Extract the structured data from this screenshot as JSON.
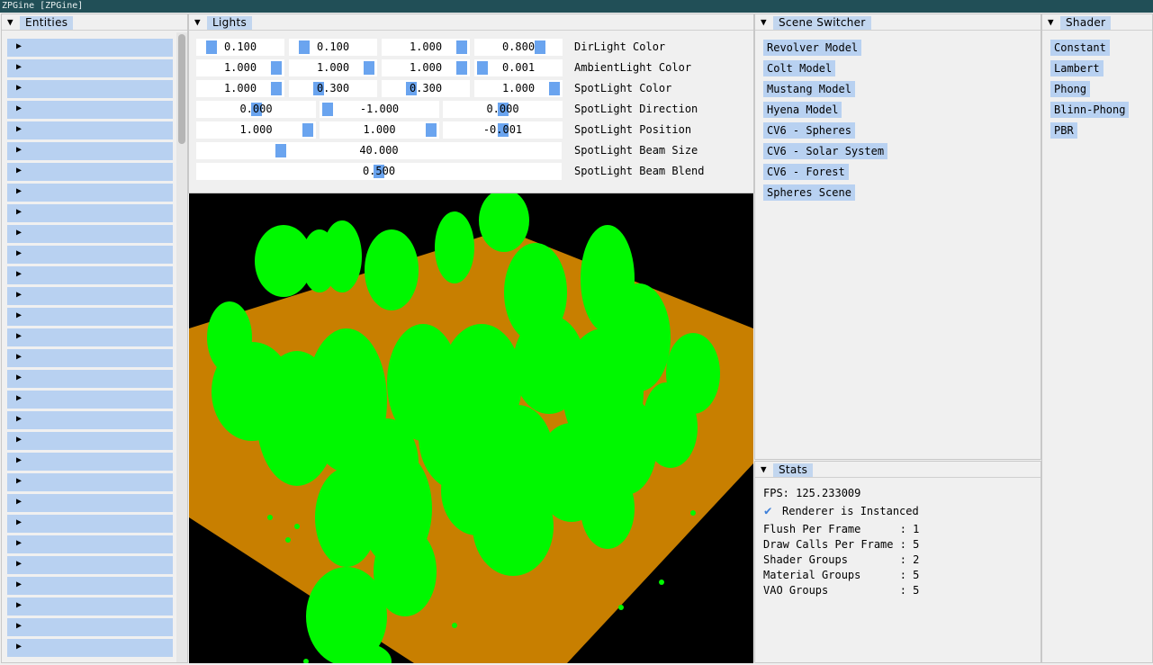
{
  "window": {
    "title": "ZPGine [ZPGine]"
  },
  "entities": {
    "title": "Entities",
    "row_count": 30
  },
  "lights": {
    "title": "Lights",
    "rows": [
      {
        "label": "DirLight Color",
        "values": [
          "0.100",
          "0.100",
          "1.000",
          "0.800"
        ],
        "fractions": [
          0.1,
          0.1,
          1.0,
          0.8
        ]
      },
      {
        "label": "AmbientLight Color",
        "values": [
          "1.000",
          "1.000",
          "1.000",
          "0.001"
        ],
        "fractions": [
          1.0,
          1.0,
          1.0,
          0.001
        ]
      },
      {
        "label": "SpotLight Color",
        "values": [
          "1.000",
          "0.300",
          "0.300",
          "1.000"
        ],
        "fractions": [
          1.0,
          0.3,
          0.3,
          1.0
        ]
      },
      {
        "label": "SpotLight Direction",
        "values": [
          "0.000",
          "-1.000",
          "0.000"
        ],
        "fractions": [
          0.5,
          0.0,
          0.5
        ]
      },
      {
        "label": "SpotLight Position",
        "values": [
          "1.000",
          "1.000",
          "-0.001"
        ],
        "fractions": [
          1.0,
          1.0,
          0.5
        ]
      },
      {
        "label": "SpotLight Beam Size",
        "values": [
          "40.000"
        ],
        "fractions": [
          0.22
        ]
      },
      {
        "label": "SpotLight Beam Blend",
        "values": [
          "0.500"
        ],
        "fractions": [
          0.5
        ]
      }
    ]
  },
  "viewport": {
    "colors": {
      "background": "#000000",
      "ground": "#c87f00",
      "trees": "#00f800"
    }
  },
  "scene_switcher": {
    "title": "Scene Switcher",
    "items": [
      "Revolver Model",
      "Colt Model",
      "Mustang Model",
      "Hyena Model",
      "CV6 - Spheres",
      "CV6 - Solar System",
      "CV6 - Forest",
      "Spheres Scene"
    ]
  },
  "stats": {
    "title": "Stats",
    "fps": "FPS: 125.233009",
    "instanced_label": "Renderer is Instanced",
    "instanced_checked": true,
    "lines": [
      "Flush Per Frame      : 1",
      "Draw Calls Per Frame : 5",
      "Shader Groups        : 2",
      "Material Groups      : 5",
      "VAO Groups           : 5"
    ]
  },
  "shader": {
    "title": "Shader",
    "items": [
      "Constant",
      "Lambert",
      "Phong",
      "Blinn-Phong",
      "PBR"
    ]
  },
  "theme": {
    "accent": "#b8d1f1",
    "slider_knob": "#6aa4ef",
    "titlebar": "#214f57",
    "check": "#3d7fd9"
  },
  "icons": {
    "collapse": "triangle-down-icon",
    "expand": "triangle-right-icon",
    "check": "checkmark-icon"
  }
}
